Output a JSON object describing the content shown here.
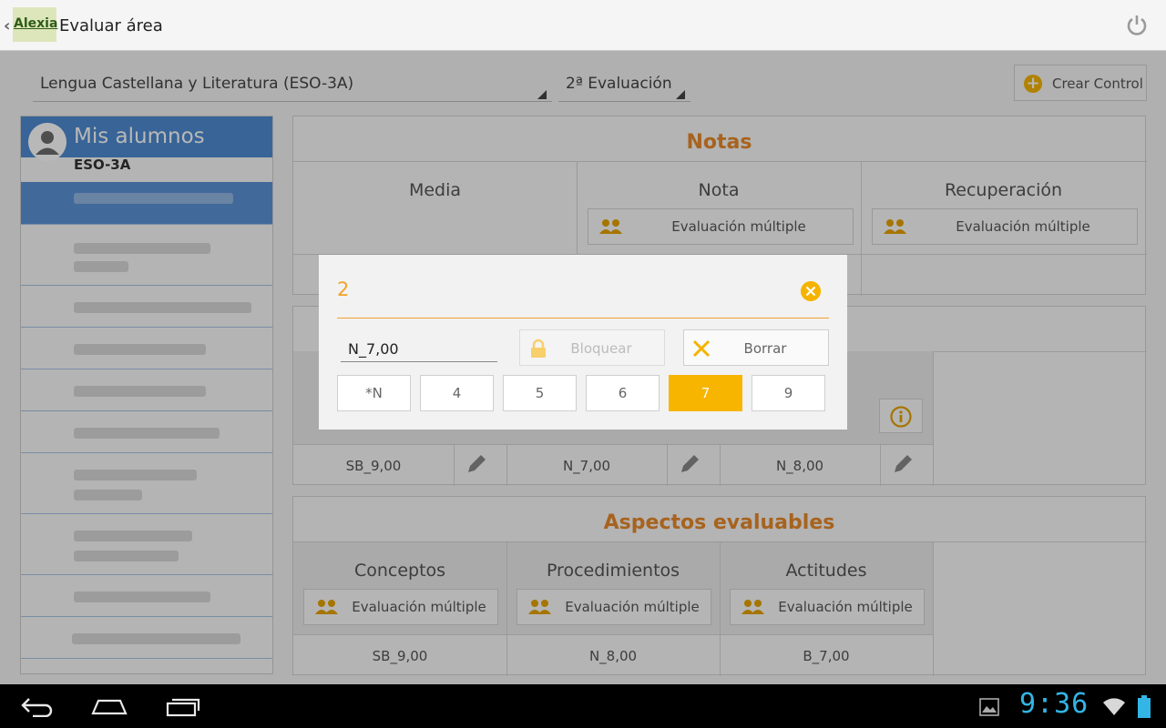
{
  "topbar": {
    "logo_text": "Alexia",
    "title": "Evaluar área",
    "power_icon": "power-icon"
  },
  "filters": {
    "subject": "Lengua Castellana y Literatura (ESO-3A)",
    "evaluation": "2ª Evaluación",
    "create_control": "Crear Control"
  },
  "sidebar": {
    "title": "Mis alumnos",
    "group": "ESO-3A"
  },
  "notas": {
    "title": "Notas",
    "columns": [
      "Media",
      "Nota",
      "Recuperación"
    ],
    "multi_label": "Evaluación múltiple"
  },
  "middle": {
    "grades": [
      "SB_9,00",
      "N_7,00",
      "N_8,00"
    ]
  },
  "aspectos": {
    "title": "Aspectos evaluables",
    "columns": [
      "Conceptos",
      "Procedimientos",
      "Actitudes"
    ],
    "multi_label": "Evaluación múltiple",
    "grades": [
      "SB_9,00",
      "N_8,00",
      "B_7,00"
    ]
  },
  "dialog": {
    "title": "2",
    "input_value": "N_7,00",
    "lock_label": "Bloquear",
    "clear_label": "Borrar",
    "grade_buttons": [
      "*N",
      "4",
      "5",
      "6",
      "7",
      "9"
    ],
    "selected": "7"
  },
  "statusbar": {
    "clock": "9:36"
  },
  "colors": {
    "accent": "#f8b500",
    "title_orange": "#e8892a",
    "sidebar_blue": "#4e8bd1",
    "clock_blue": "#33b5e5"
  }
}
